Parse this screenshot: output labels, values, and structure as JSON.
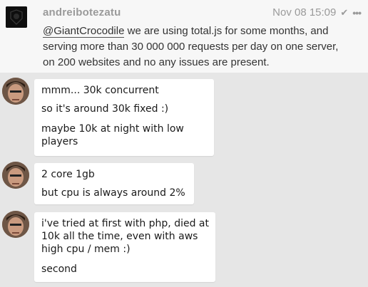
{
  "message": {
    "username": "andreibotezatu",
    "timestamp": "Nov 08 15:09",
    "mention": "@GiantCrocodile",
    "text_line1_rest": " we are using total.js for some months, and",
    "text_line2": "serving more than 30 000 000 requests per day on one server,",
    "text_line3": "on 200 websites and no any issues are present."
  },
  "chat": [
    {
      "lines": [
        "mmm... 30k concurrent",
        "so it's around 30k fixed :)",
        "maybe 10k at night with low",
        "players"
      ]
    },
    {
      "lines": [
        "2 core 1gb",
        "but cpu is always around 2%"
      ]
    },
    {
      "lines": [
        "i've tried at first with php, died at",
        "10k all the time, even with aws",
        "high cpu / mem :)",
        "second"
      ]
    }
  ]
}
